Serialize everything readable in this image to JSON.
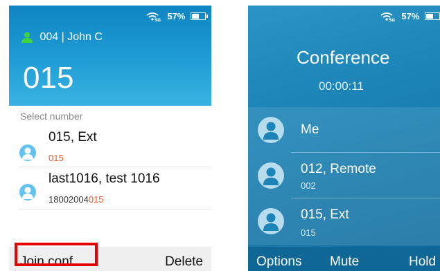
{
  "left_screen": {
    "status": {
      "battery_text": "57%",
      "battery_level": 0.57
    },
    "line_info": "004 | John C",
    "dialed_number": "015",
    "select_label": "Select number",
    "candidates": [
      {
        "name": "015, Ext",
        "number_prefix": "",
        "number_match": "015"
      },
      {
        "name": "last1016, test 1016",
        "number_prefix": "18002004",
        "number_match": "015"
      }
    ],
    "softkeys": {
      "left": "Join conf",
      "right": "Delete"
    }
  },
  "right_screen": {
    "status": {
      "battery_text": "57%",
      "battery_level": 0.57
    },
    "title": "Conference",
    "timer": "00:00:11",
    "participants": [
      {
        "name": "Me",
        "number": ""
      },
      {
        "name": "012, Remote",
        "number": "002"
      },
      {
        "name": "015, Ext",
        "number": "015"
      }
    ],
    "softkeys": {
      "left": "Options",
      "middle": "Mute",
      "right": "Hold"
    }
  },
  "colors": {
    "header_blue": "#1f9dd5",
    "match_highlight": "#f0582c",
    "line_icon_green": "#3fd33f",
    "annotation_red": "#e60000"
  },
  "icons": [
    "wifi-5g-icon",
    "battery-icon",
    "line-person-icon",
    "contact-avatar-icon"
  ]
}
